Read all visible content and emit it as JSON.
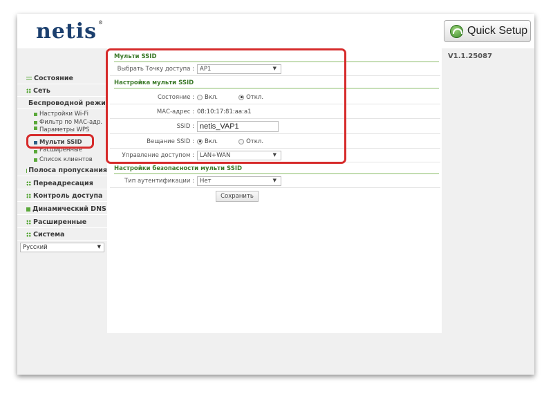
{
  "header": {
    "logo_text": "netis",
    "logo_tm": "®",
    "quick_setup_label": "Quick Setup"
  },
  "version": "V1.1.25087",
  "sidebar": {
    "items": [
      {
        "label": "Состояние"
      },
      {
        "label": "Сеть"
      },
      {
        "label": "Беспроводной режим"
      },
      {
        "label": "Настройки Wi-Fi"
      },
      {
        "label": "Фильтр по МАС-адр."
      },
      {
        "label": "Параметры WPS"
      },
      {
        "label": "Мульти SSID"
      },
      {
        "label": "Расширенные"
      },
      {
        "label": "Список клиентов"
      },
      {
        "label": "Полоса пропускания"
      },
      {
        "label": "Переадресация"
      },
      {
        "label": "Контроль доступа"
      },
      {
        "label": "Динамический DNS"
      },
      {
        "label": "Расширенные"
      },
      {
        "label": "Система"
      }
    ],
    "language": "Русский"
  },
  "multi_ssid": {
    "title": "Мульти SSID",
    "ap_label": "Выбрать Точку доступа :",
    "ap_value": "AP1"
  },
  "settings": {
    "title": "Настройка мульти SSID",
    "status_label": "Состояние :",
    "status_on": "Вкл.",
    "status_off": "Откл.",
    "mac_label": "МАС-адрес :",
    "mac_value": "08:10:17:81:aa:a1",
    "ssid_label": "SSID :",
    "ssid_value": "netis_VAP1",
    "broadcast_label": "Вещание SSID :",
    "broadcast_on": "Вкл.",
    "broadcast_off": "Откл.",
    "access_label": "Управление доступом :",
    "access_value": "LAN+WAN"
  },
  "security": {
    "title": "Настройки безопасности мульти SSID",
    "auth_label": "Тип аутентификации :",
    "auth_value": "Нет",
    "save_label": "Сохранить"
  },
  "colors": {
    "accent_green": "#5aa83a",
    "highlight_red": "#d62b2b",
    "logo_blue": "#1b3f6e"
  }
}
